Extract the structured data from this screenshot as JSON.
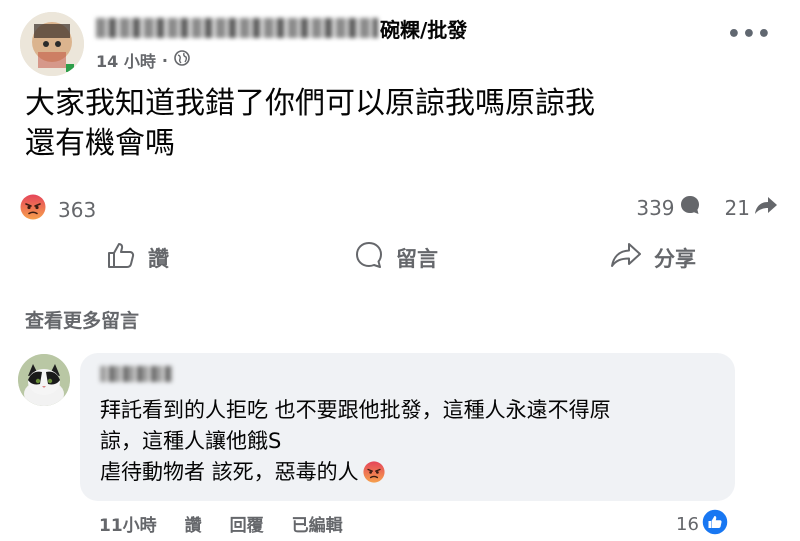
{
  "post": {
    "page_name_suffix": "碗粿/批發",
    "time": "14 小時",
    "audience_icon": "globe-icon",
    "text_line1": "大家我知道我錯了你們可以原諒我嗎原諒我",
    "text_line2": "還有機會嗎",
    "reaction_icon": "angry-emoji-icon",
    "reaction_count": "363",
    "comment_count": "339",
    "share_count": "21"
  },
  "actions": {
    "like_label": "讚",
    "comment_label": "留言",
    "share_label": "分享"
  },
  "comments": {
    "view_more_label": "查看更多留言",
    "items": [
      {
        "text_line1": "拜託看到的人拒吃 也不要跟他批發，這種人永遠不得原",
        "text_line2": "諒，這種人讓他餓S",
        "text_line3": "虐待動物者 該死，惡毒的人",
        "time": "11小時",
        "like_label": "讚",
        "reply_label": "回覆",
        "edited_label": "已編輯",
        "likes": "16"
      }
    ]
  },
  "colors": {
    "secondary_text": "#65676b",
    "bubble_bg": "#f0f2f5",
    "like_blue": "#1877f2",
    "angry_top": "#e5455a",
    "angry_bottom": "#f6a04d"
  }
}
